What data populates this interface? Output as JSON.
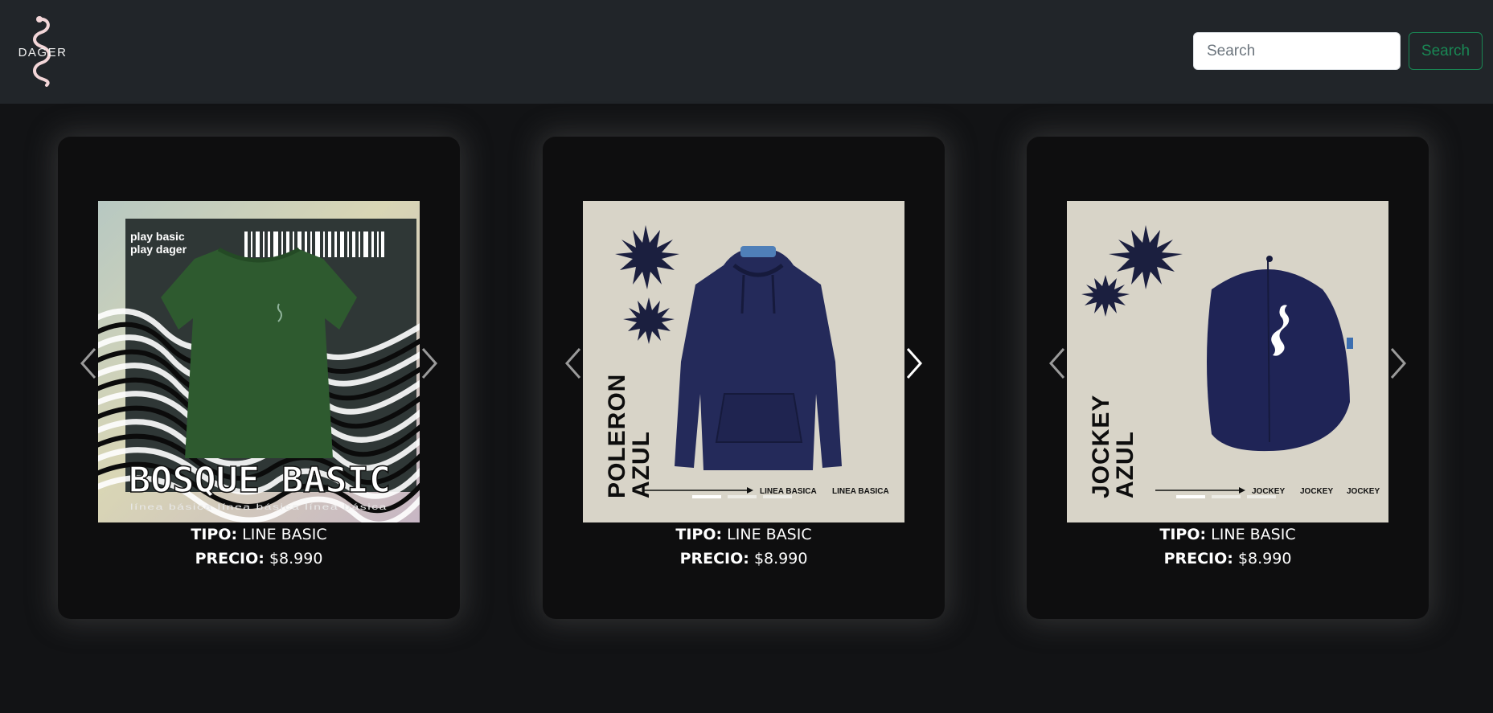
{
  "brand": {
    "logo_text": "DAGER"
  },
  "search": {
    "placeholder": "Search",
    "button_label": "Search"
  },
  "products": [
    {
      "image": {
        "headline": "BOSQUE BASIC",
        "tagline_1": "play basic",
        "tagline_2": "play dager",
        "footer": "línea básica   línea básica   línea básica"
      },
      "tipo_label": "TIPO:",
      "tipo_value": "LINE BASIC",
      "precio_label": "PRECIO:",
      "precio_value": "$8.990"
    },
    {
      "image": {
        "line_1": "POLERON",
        "line_2": "AZUL",
        "footer_1": "LINEA BASICA",
        "footer_2": "LINEA BASICA"
      },
      "tipo_label": "TIPO:",
      "tipo_value": "LINE BASIC",
      "precio_label": "PRECIO:",
      "precio_value": "$8.990"
    },
    {
      "image": {
        "line_1": "JOCKEY",
        "line_2": "AZUL",
        "footer_1": "JOCKEY",
        "footer_2": "JOCKEY",
        "footer_3": "JOCKEY"
      },
      "tipo_label": "TIPO:",
      "tipo_value": "LINE BASIC",
      "precio_label": "PRECIO:",
      "precio_value": "$8.990"
    }
  ],
  "icons": {
    "logo": "snake-logo-icon",
    "prev": "chevron-left-icon",
    "next": "chevron-right-icon"
  },
  "colors": {
    "navbar": "#212529",
    "page_bg": "#121315",
    "card_bg": "#0e0e0f",
    "accent_green": "#198754",
    "product_navy": "#1f2456",
    "shirt_green": "#2e5a2f",
    "image_beige": "#d8d4c8"
  }
}
